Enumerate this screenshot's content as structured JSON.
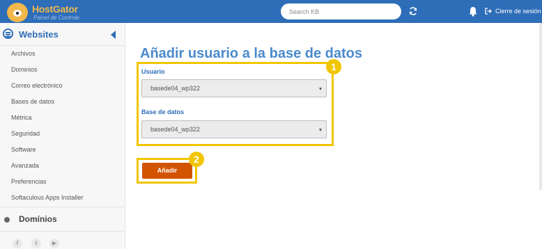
{
  "header": {
    "brand": "HostGator",
    "brand_subtitle": "Painel de Controle",
    "search_placeholder": "Search KB",
    "logout_label": "Cierre de sesión",
    "icons": [
      "refresh-icon",
      "bell-icon",
      "logout-icon"
    ],
    "bg_color": "#2e6db8"
  },
  "sidebar": {
    "section_title": "Websites",
    "items": [
      {
        "label": "Archivos"
      },
      {
        "label": "Dominios"
      },
      {
        "label": "Correo electrónico"
      },
      {
        "label": "Bases de datos"
      },
      {
        "label": "Métrica"
      },
      {
        "label": "Seguridad"
      },
      {
        "label": "Software"
      },
      {
        "label": "Avanzada"
      },
      {
        "label": "Preferencias"
      },
      {
        "label": "Softaculous Apps Installer"
      }
    ],
    "second_section_title": "Domínios",
    "social": [
      {
        "icon": "facebook-icon",
        "glyph": "f"
      },
      {
        "icon": "twitter-icon",
        "glyph": "t"
      },
      {
        "icon": "youtube-icon",
        "glyph": "▶"
      }
    ]
  },
  "main": {
    "title": "Añadir usuario a la base de datos",
    "form": {
      "user_label": "Usuario",
      "user_value": "basede04_wp322",
      "db_label": "Base de datos",
      "db_value": "basede04_wp322"
    },
    "add_button": "Añadir",
    "badges": [
      "1",
      "2"
    ],
    "highlight_color": "#f1c500",
    "button_color": "#d35400"
  }
}
